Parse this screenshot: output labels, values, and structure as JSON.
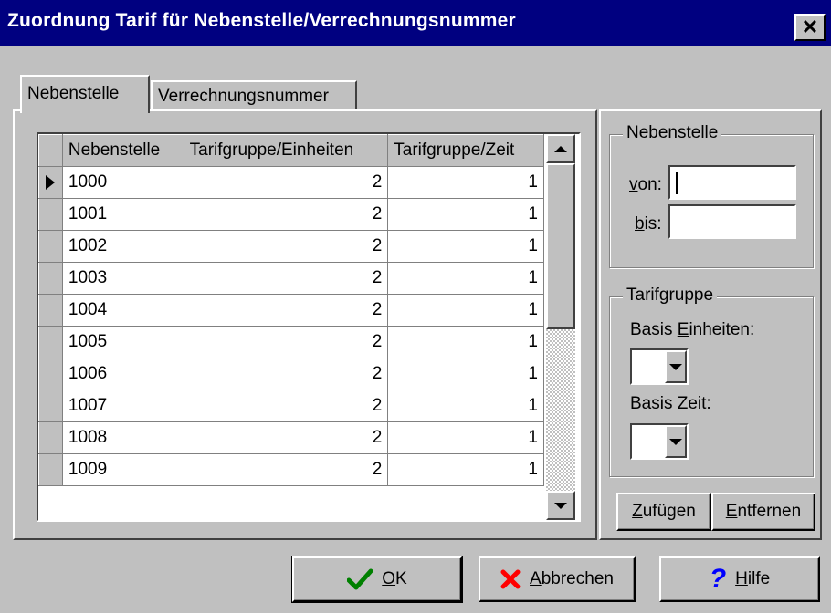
{
  "window": {
    "title": "Zuordnung Tarif für Nebenstelle/Verrechnungsnummer",
    "close_glyph": "✕"
  },
  "tabs": [
    {
      "label": "Nebenstelle",
      "active": true
    },
    {
      "label": "Verrechnungsnummer",
      "active": false
    }
  ],
  "grid": {
    "columns": [
      "Nebenstelle",
      "Tarifgruppe/Einheiten",
      "Tarifgruppe/Zeit"
    ],
    "rows": [
      {
        "nebenstelle": "1000",
        "einheiten": "2",
        "zeit": "1",
        "current": true
      },
      {
        "nebenstelle": "1001",
        "einheiten": "2",
        "zeit": "1"
      },
      {
        "nebenstelle": "1002",
        "einheiten": "2",
        "zeit": "1"
      },
      {
        "nebenstelle": "1003",
        "einheiten": "2",
        "zeit": "1"
      },
      {
        "nebenstelle": "1004",
        "einheiten": "2",
        "zeit": "1"
      },
      {
        "nebenstelle": "1005",
        "einheiten": "2",
        "zeit": "1"
      },
      {
        "nebenstelle": "1006",
        "einheiten": "2",
        "zeit": "1"
      },
      {
        "nebenstelle": "1007",
        "einheiten": "2",
        "zeit": "1"
      },
      {
        "nebenstelle": "1008",
        "einheiten": "2",
        "zeit": "1"
      },
      {
        "nebenstelle": "1009",
        "einheiten": "2",
        "zeit": "1"
      }
    ]
  },
  "nebenstelle_group": {
    "caption": "Nebenstelle",
    "von": {
      "accel": "v",
      "rest": "on:",
      "value": ""
    },
    "bis": {
      "accel": "b",
      "rest": "is:",
      "value": ""
    }
  },
  "tarifgruppe_group": {
    "caption": "Tarifgruppe",
    "basis_einheiten": {
      "pre": "Basis ",
      "accel": "E",
      "rest": "inheiten:",
      "value": ""
    },
    "basis_zeit": {
      "pre": "Basis ",
      "accel": "Z",
      "rest": "eit:",
      "value": ""
    }
  },
  "actions": {
    "zufuegen": {
      "accel": "Z",
      "rest": "ufügen"
    },
    "entfernen": {
      "accel": "E",
      "rest": "ntfernen"
    }
  },
  "buttons": {
    "ok": {
      "accel": "O",
      "rest": "K",
      "icon": "checkmark-icon"
    },
    "abbrechen": {
      "accel": "A",
      "rest": "bbrechen",
      "icon": "x-mark-icon"
    },
    "hilfe": {
      "accel": "H",
      "rest": "ilfe",
      "icon": "question-mark-icon"
    }
  },
  "colors": {
    "title_bar": "#000080",
    "ok_check": "#008000",
    "cancel_x": "#ff0000",
    "help_q": "#0000ff"
  }
}
